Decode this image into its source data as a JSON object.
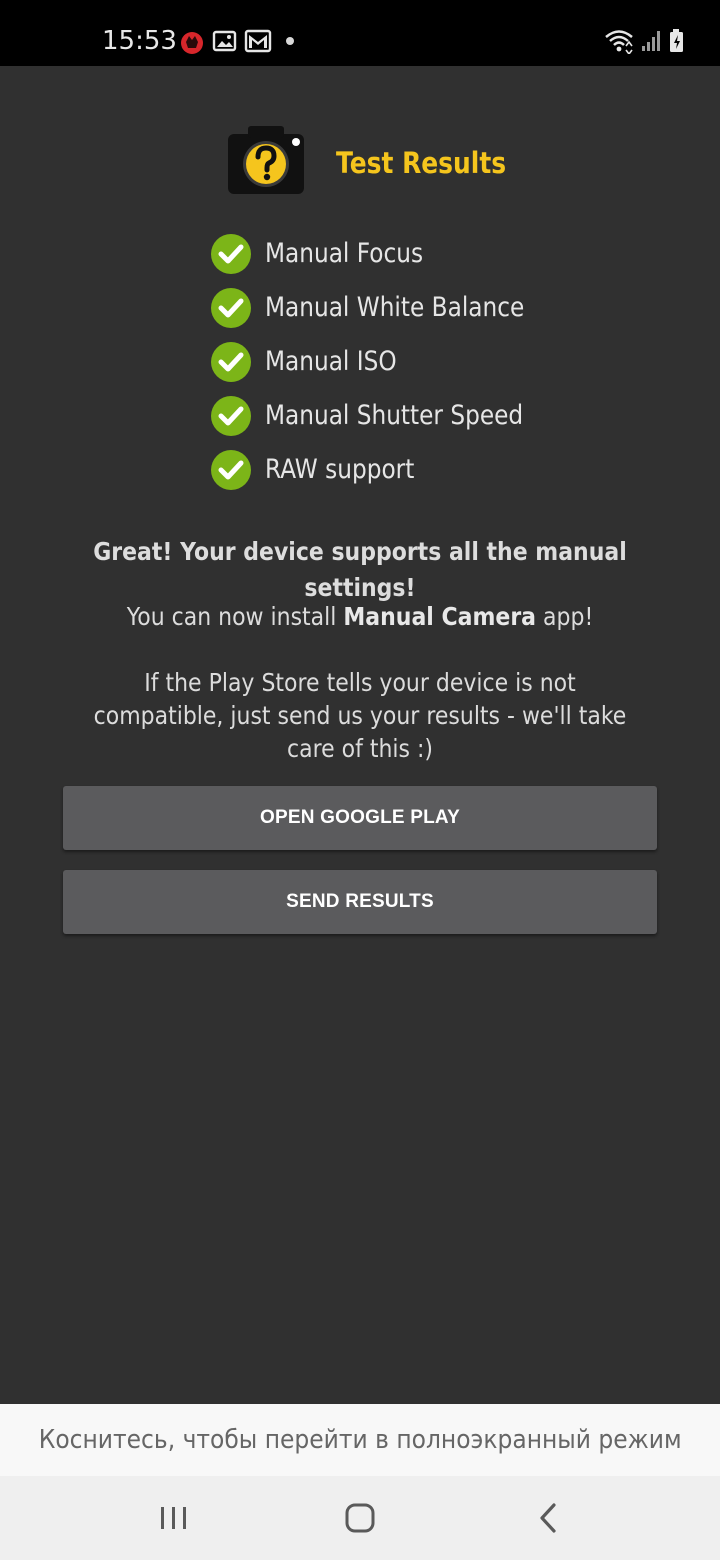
{
  "status_bar": {
    "time": "15:53",
    "icons": [
      "app-notification-icon",
      "gallery-icon",
      "gmail-icon",
      "more-dot-icon",
      "wifi-icon",
      "signal-icon",
      "battery-charging-icon"
    ]
  },
  "header": {
    "title": "Test Results",
    "icon": "camera-question-icon"
  },
  "checks": [
    {
      "label": "Manual Focus",
      "status": "passed"
    },
    {
      "label": "Manual White Balance",
      "status": "passed"
    },
    {
      "label": "Manual ISO",
      "status": "passed"
    },
    {
      "label": "Manual Shutter Speed",
      "status": "passed"
    },
    {
      "label": "RAW support",
      "status": "passed"
    }
  ],
  "messages": {
    "great": "Great! Your device supports all the manual settings!",
    "install_prefix": "You can now install ",
    "install_app": "Manual Camera",
    "install_suffix": " app!",
    "note": "If the Play Store tells your device is not compatible, just send us your results - we'll take care of this :)"
  },
  "buttons": {
    "open_google_play": "OPEN GOOGLE PLAY",
    "send_results": "SEND RESULTS"
  },
  "toast": {
    "text": "Коснитесь, чтобы перейти в полноэкранный режим"
  },
  "nav_bar": {
    "buttons": [
      "recent-apps-icon",
      "home-icon",
      "back-icon"
    ]
  },
  "colors": {
    "background": "#303030",
    "accent_yellow": "#f5c51d",
    "check_green": "#7cb518",
    "button_bg": "#5b5b5d"
  }
}
